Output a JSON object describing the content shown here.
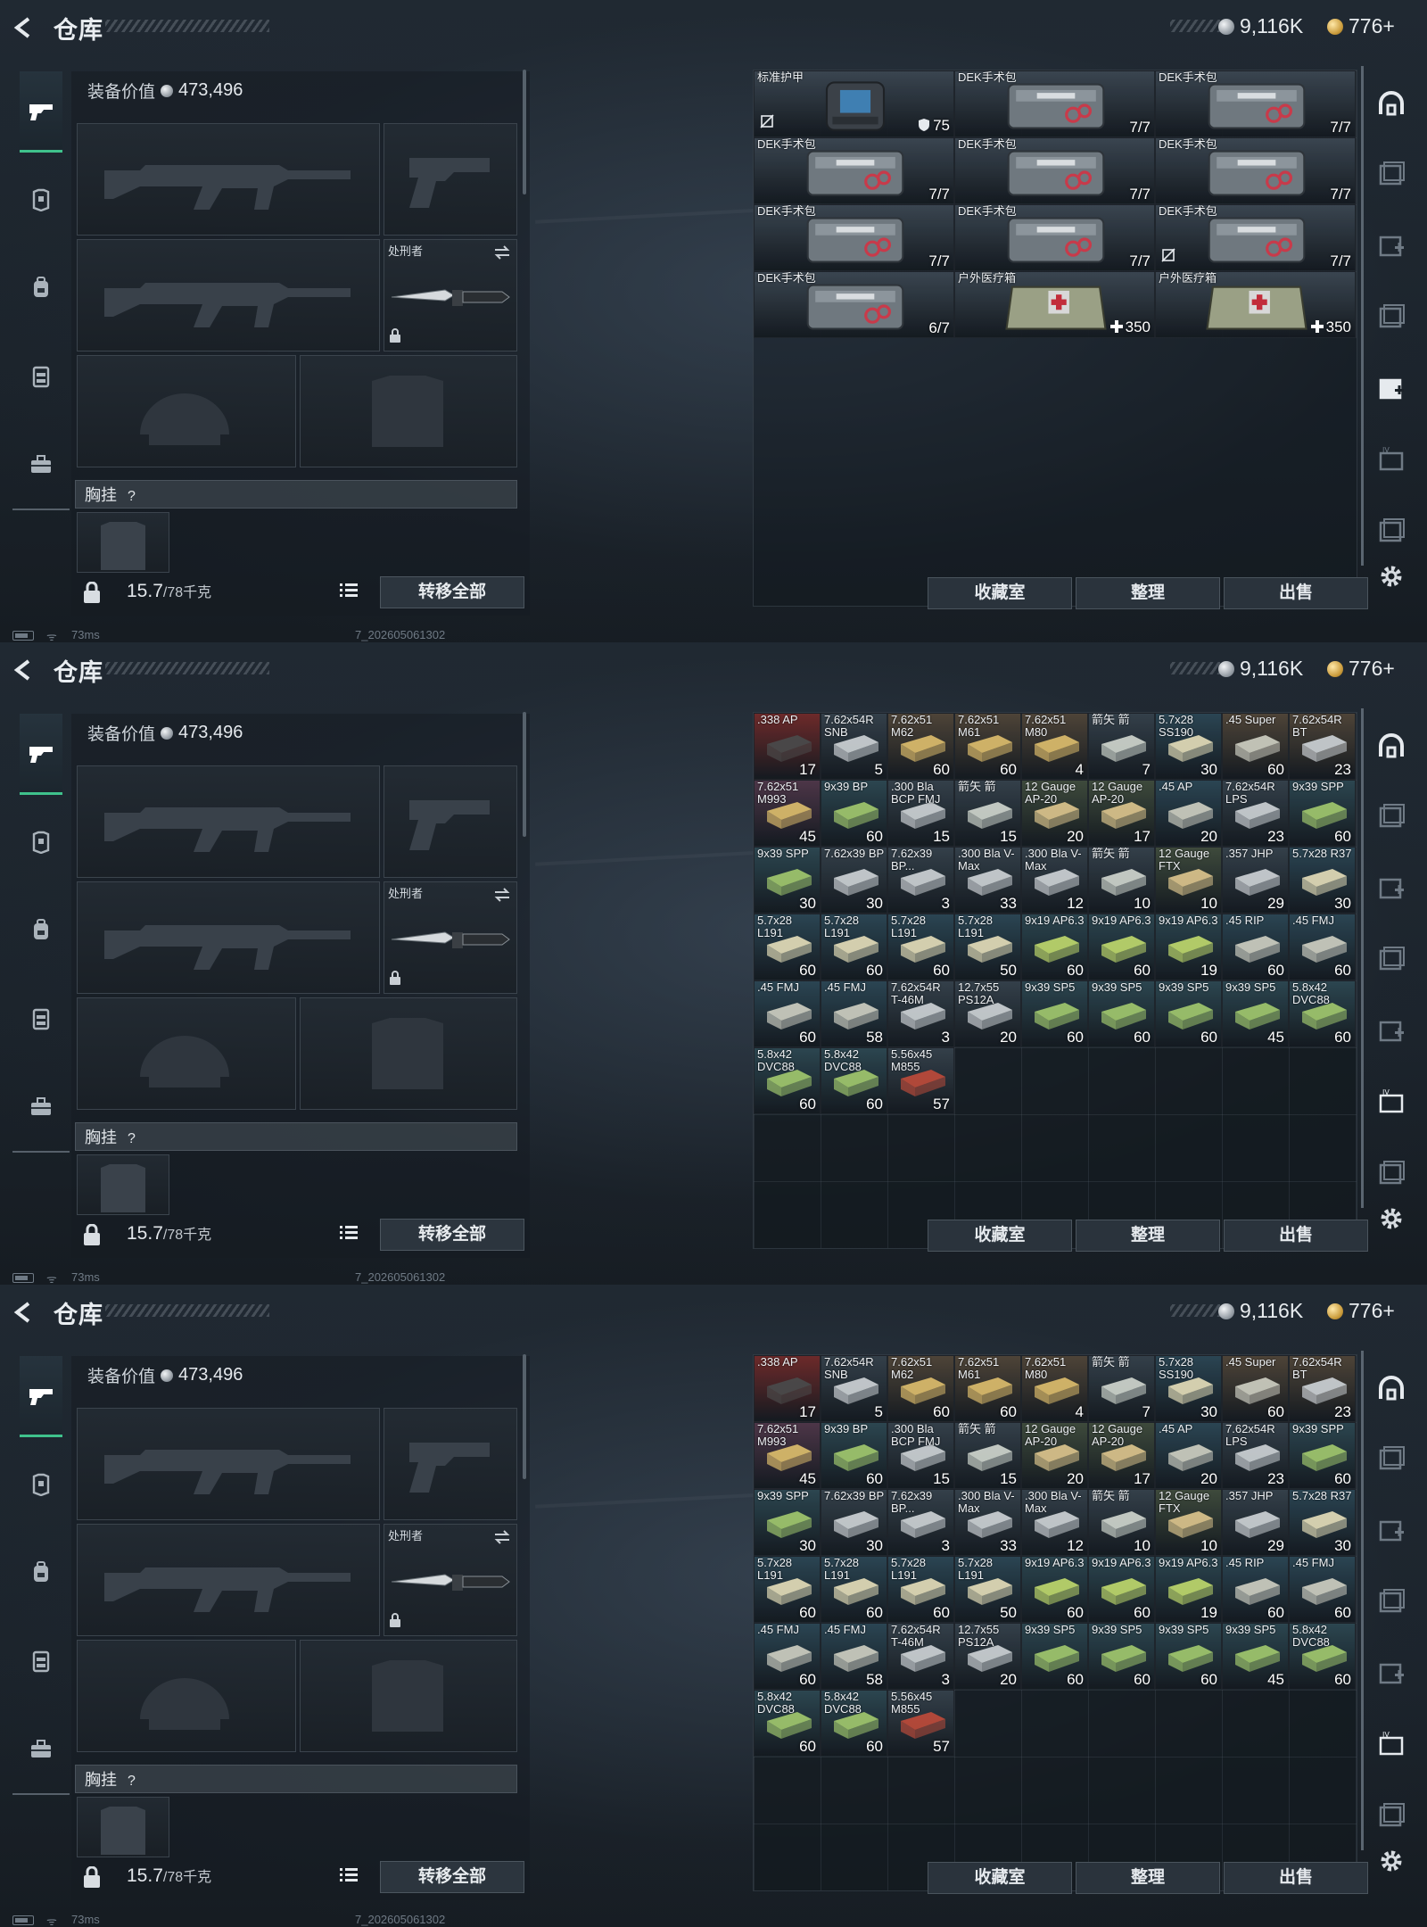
{
  "header": {
    "title": "仓库",
    "silver": "9,116K",
    "gold": "776+"
  },
  "loadout": {
    "equip_value_label": "装备价值",
    "equip_value": "473,496",
    "melee_label": "处刑者",
    "rig_label": "胸挂",
    "rig_help": "?",
    "weight": "15.7",
    "weight_cap": "/78千克",
    "transfer_all": "转移全部"
  },
  "stash_buttons": [
    "收藏室",
    "整理",
    "出售"
  ],
  "status": {
    "ping": "73ms",
    "build": "7_202605061302"
  },
  "colors": {
    "accent_green": "#3fc28c",
    "bg": "#1a2128"
  },
  "frames": [
    {
      "view": "medical",
      "items": [
        {
          "name": "标准护甲",
          "count": "75",
          "mark": "armor",
          "art": "armor",
          "icon": "slash-icon"
        },
        {
          "name": "DEK手术包",
          "count": "7/7",
          "art": "kit"
        },
        {
          "name": "DEK手术包",
          "count": "7/7",
          "art": "kit"
        },
        {
          "name": "DEK手术包",
          "count": "7/7",
          "art": "kit"
        },
        {
          "name": "DEK手术包",
          "count": "7/7",
          "art": "kit"
        },
        {
          "name": "DEK手术包",
          "count": "7/7",
          "art": "kit"
        },
        {
          "name": "DEK手术包",
          "count": "7/7",
          "art": "kit"
        },
        {
          "name": "DEK手术包",
          "count": "7/7",
          "art": "kit"
        },
        {
          "name": "DEK手术包",
          "count": "7/7",
          "art": "kit",
          "icon": "slash-icon"
        },
        {
          "name": "DEK手术包",
          "count": "6/7",
          "art": "kit"
        },
        {
          "name": "户外医疗箱",
          "count": "350",
          "mark": "plus",
          "art": "medbox"
        },
        {
          "name": "户外医疗箱",
          "count": "350",
          "mark": "plus",
          "art": "medbox"
        }
      ]
    },
    {
      "view": "ammo",
      "items": [
        {
          "name": ".338 AP",
          "count": "17",
          "color": "#7a2e2e"
        },
        {
          "name": "7.62x54R SNB",
          "count": "5",
          "color": "#3a4a58"
        },
        {
          "name": "7.62x51 M62",
          "count": "60",
          "color": "#3a4a58"
        },
        {
          "name": "7.62x51 M61",
          "count": "60",
          "color": "#3a4a58"
        },
        {
          "name": "7.62x51 M80",
          "count": "4",
          "color": "#3a4a58"
        },
        {
          "name": "箭矢 箭",
          "count": "7",
          "color": "#3a4a58"
        },
        {
          "name": "5.7x28 SS190",
          "count": "30",
          "color": "#3a4a58"
        },
        {
          "name": ".45 Super",
          "count": "60",
          "color": "#3a4a58"
        },
        {
          "name": "7.62x54R BT",
          "count": "23",
          "color": "#3a4a58"
        },
        {
          "name": "7.62x51 M993",
          "count": "45",
          "color": "#4a3a4a"
        },
        {
          "name": "9x39 BP",
          "count": "60",
          "color": "#3a4a58"
        },
        {
          "name": ".300 Bla BCP FMJ",
          "count": "15",
          "color": "#3a4a58"
        },
        {
          "name": "箭矢 箭",
          "count": "15",
          "color": "#3a4a58"
        },
        {
          "name": "12 Gauge AP-20",
          "count": "20",
          "color": "#3a4a58"
        },
        {
          "name": "12 Gauge AP-20",
          "count": "17",
          "color": "#3a4a58"
        },
        {
          "name": ".45 AP",
          "count": "20",
          "color": "#3a4a58"
        },
        {
          "name": "7.62x54R LPS",
          "count": "23",
          "color": "#3a4a58"
        },
        {
          "name": "9x39 SPP",
          "count": "60",
          "color": "#3a4a58"
        },
        {
          "name": "9x39 SPP",
          "count": "30",
          "color": "#3a4a58"
        },
        {
          "name": "7.62x39 BP",
          "count": "30",
          "color": "#3a4a58"
        },
        {
          "name": "7.62x39 BP...",
          "count": "3",
          "color": "#3a4a58"
        },
        {
          "name": ".300 Bla V-Max",
          "count": "33",
          "color": "#3a4a58"
        },
        {
          "name": ".300 Bla V-Max",
          "count": "12",
          "color": "#3a4a58"
        },
        {
          "name": "箭矢 箭",
          "count": "10",
          "color": "#3a4a58"
        },
        {
          "name": "12 Gauge FTX",
          "count": "10",
          "color": "#3a4a58"
        },
        {
          "name": ".357 JHP",
          "count": "29",
          "color": "#3a4a58"
        },
        {
          "name": "5.7x28 R37",
          "count": "30",
          "color": "#3a4a58"
        },
        {
          "name": "5.7x28 L191",
          "count": "60",
          "color": "#3a4a58"
        },
        {
          "name": "5.7x28 L191",
          "count": "60",
          "color": "#3a4a58"
        },
        {
          "name": "5.7x28 L191",
          "count": "60",
          "color": "#3a4a58"
        },
        {
          "name": "5.7x28 L191",
          "count": "50",
          "color": "#3a4a58"
        },
        {
          "name": "9x19 AP6.3",
          "count": "60",
          "color": "#3a4a58"
        },
        {
          "name": "9x19 AP6.3",
          "count": "60",
          "color": "#3a4a58"
        },
        {
          "name": "9x19 AP6.3",
          "count": "19",
          "color": "#3a4a58"
        },
        {
          "name": ".45 RIP",
          "count": "60",
          "color": "#3a4a58"
        },
        {
          "name": ".45 FMJ",
          "count": "60",
          "color": "#3a4a58"
        },
        {
          "name": ".45 FMJ",
          "count": "60",
          "color": "#3a4a58"
        },
        {
          "name": ".45 FMJ",
          "count": "58",
          "color": "#3a4a58"
        },
        {
          "name": "7.62x54R T-46M",
          "count": "3",
          "color": "#3a4a58"
        },
        {
          "name": "12.7x55 PS12A",
          "count": "20",
          "color": "#3a4a58"
        },
        {
          "name": "9x39 SP5",
          "count": "60",
          "color": "#3a4a58"
        },
        {
          "name": "9x39 SP5",
          "count": "60",
          "color": "#3a4a58"
        },
        {
          "name": "9x39 SP5",
          "count": "60",
          "color": "#3a4a58"
        },
        {
          "name": "9x39 SP5",
          "count": "45",
          "color": "#3a4a58"
        },
        {
          "name": "5.8x42 DVC88",
          "count": "60",
          "color": "#3a4a58"
        },
        {
          "name": "5.8x42 DVC88",
          "count": "60",
          "color": "#3a4a58"
        },
        {
          "name": "5.8x42 DVC88",
          "count": "60",
          "color": "#3a4a58"
        },
        {
          "name": "5.56x45 M855",
          "count": "57",
          "color": "#3a4a58"
        }
      ]
    },
    {
      "view": "ammo",
      "items": "same-as-frame-2"
    }
  ]
}
